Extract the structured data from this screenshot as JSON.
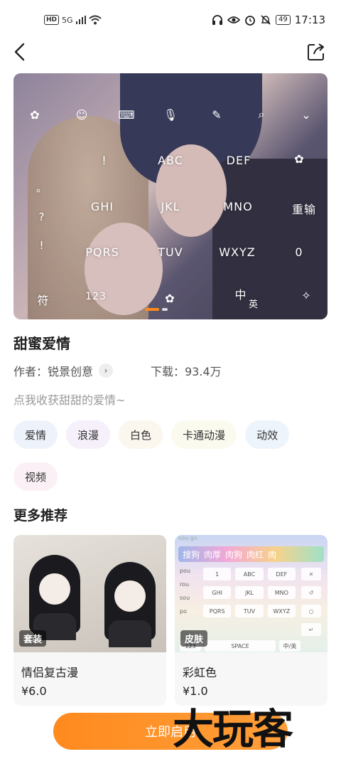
{
  "status_bar": {
    "hd": "HD",
    "network": "5G",
    "battery": "49",
    "time": "17:13"
  },
  "skin": {
    "title": "甜蜜爱情",
    "author_label": "作者：锐景创意",
    "downloads_label": "下载：93.4万",
    "description": "点我收获甜甜的爱情~",
    "tags": [
      "爱情",
      "浪漫",
      "白色",
      "卡通动漫",
      "动效",
      "视频"
    ]
  },
  "preview_keyboard": {
    "row1": [
      "!",
      "ABC",
      "DEF"
    ],
    "row2": [
      "GHI",
      "JKL",
      "MNO",
      "重输"
    ],
    "row3": [
      "PQRS",
      "TUV",
      "WXYZ",
      "0"
    ],
    "row4": [
      "符",
      "123",
      "中",
      "英"
    ],
    "left_keys": [
      "。",
      "?",
      "!"
    ]
  },
  "more": {
    "section_title": "更多推荐",
    "cards": [
      {
        "name": "情侣复古漫",
        "price": "¥6.0",
        "badge": "套装"
      },
      {
        "name": "彩虹色",
        "price": "¥1.0",
        "badge": "皮肤"
      }
    ],
    "rainbow_preview": {
      "brand": "sou go",
      "candidates": [
        "搜狗",
        "肉厚",
        "肉狗",
        "肉红",
        "肉"
      ],
      "side": [
        "pou",
        "rou",
        "sou",
        "po"
      ],
      "keys": [
        "1",
        "ABC",
        "DEF",
        "GHI",
        "JKL",
        "MNO",
        "PQRS",
        "TUV",
        "WXYZ"
      ],
      "bottom": [
        "123",
        "SPACE",
        "中/英"
      ]
    }
  },
  "cta_label": "立即启用",
  "watermark": "大玩客",
  "colors": {
    "accent": "#FF8A1E"
  }
}
